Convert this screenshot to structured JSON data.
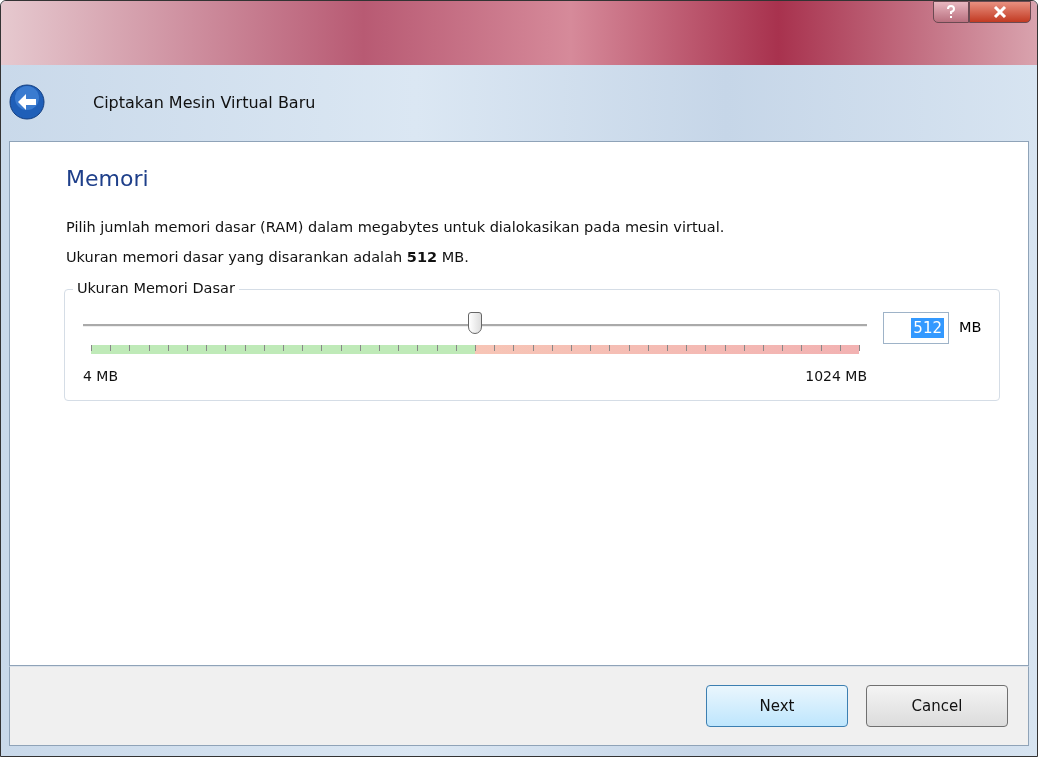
{
  "window": {
    "title": "Ciptakan Mesin Virtual Baru"
  },
  "page": {
    "heading": "Memori",
    "paragraphs": [
      "Pilih jumlah memori dasar (RAM) dalam megabytes untuk dialokasikan pada mesin virtual.",
      "Ukuran memori dasar yang disarankan adalah **512** MB."
    ]
  },
  "memory_group": {
    "label": "Ukuran Memori Dasar",
    "slider": {
      "level": 0.5,
      "min_label": "4 MB",
      "max_label": "1024 MB"
    },
    "field": {
      "value": "512",
      "selected": true,
      "unit": "MB"
    }
  },
  "buttons": [
    {
      "label": "Next",
      "default": true
    },
    {
      "label": "Cancel",
      "default": false
    }
  ]
}
